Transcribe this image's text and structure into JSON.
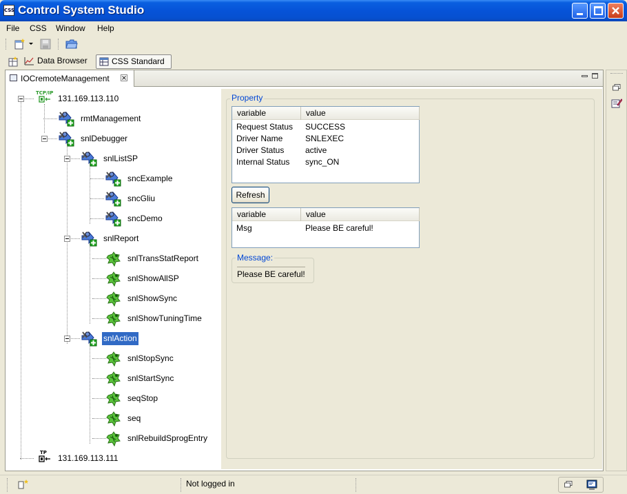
{
  "window": {
    "title": "Control System Studio",
    "app_icon_text": "CSS"
  },
  "menu": {
    "items": [
      "File",
      "CSS",
      "Window",
      "Help"
    ]
  },
  "perspectives": {
    "data_browser": "Data Browser",
    "css_standard": "CSS Standard"
  },
  "view": {
    "tab_title": "IOCremoteManagement"
  },
  "tree": {
    "nodes": [
      {
        "label": "131.169.113.110",
        "type": "tcpip",
        "icon_text": "TCP/IP",
        "selected": false
      },
      {
        "label": "rmtManagement",
        "type": "ioc",
        "selected": false
      },
      {
        "label": "snlDebugger",
        "type": "ioc",
        "selected": false
      },
      {
        "label": "snlListSP",
        "type": "ioc",
        "selected": false
      },
      {
        "label": "sncExample",
        "type": "ioc",
        "selected": false
      },
      {
        "label": "sncGliu",
        "type": "ioc",
        "selected": false
      },
      {
        "label": "sncDemo",
        "type": "ioc",
        "selected": false
      },
      {
        "label": "snlReport",
        "type": "ioc",
        "selected": false
      },
      {
        "label": "snlTransStatReport",
        "type": "leaf",
        "selected": false
      },
      {
        "label": "snlShowAllSP",
        "type": "leaf",
        "selected": false
      },
      {
        "label": "snlShowSync",
        "type": "leaf",
        "selected": false
      },
      {
        "label": "snlShowTuningTime",
        "type": "leaf",
        "selected": false
      },
      {
        "label": "snlAction",
        "type": "ioc",
        "selected": true
      },
      {
        "label": "snlStopSync",
        "type": "leaf",
        "selected": false
      },
      {
        "label": "snlStartSync",
        "type": "leaf",
        "selected": false
      },
      {
        "label": "seqStop",
        "type": "leaf",
        "selected": false
      },
      {
        "label": "seq",
        "type": "leaf",
        "selected": false
      },
      {
        "label": "snlRebuildSprogEntry",
        "type": "leaf",
        "selected": false
      },
      {
        "label": "131.169.113.111",
        "type": "tcpip",
        "icon_text": "TP",
        "selected": false
      }
    ]
  },
  "property": {
    "group_title": "Property",
    "columns": [
      "variable",
      "value"
    ],
    "rows": [
      [
        "Request Status",
        "SUCCESS"
      ],
      [
        "Driver Name",
        "SNLEXEC"
      ],
      [
        "Driver Status",
        "active"
      ],
      [
        "Internal Status",
        "sync_ON"
      ]
    ],
    "refresh_label": "Refresh",
    "result_columns": [
      "variable",
      "value"
    ],
    "result_rows": [
      [
        "Msg",
        "Please BE careful!"
      ]
    ]
  },
  "message": {
    "title": "Message:",
    "text": "Please BE careful!"
  },
  "status": {
    "login": "Not logged in"
  },
  "colors": {
    "title_bar": "#0653d8",
    "selection": "#316ac5",
    "group_title": "#0046d5"
  }
}
